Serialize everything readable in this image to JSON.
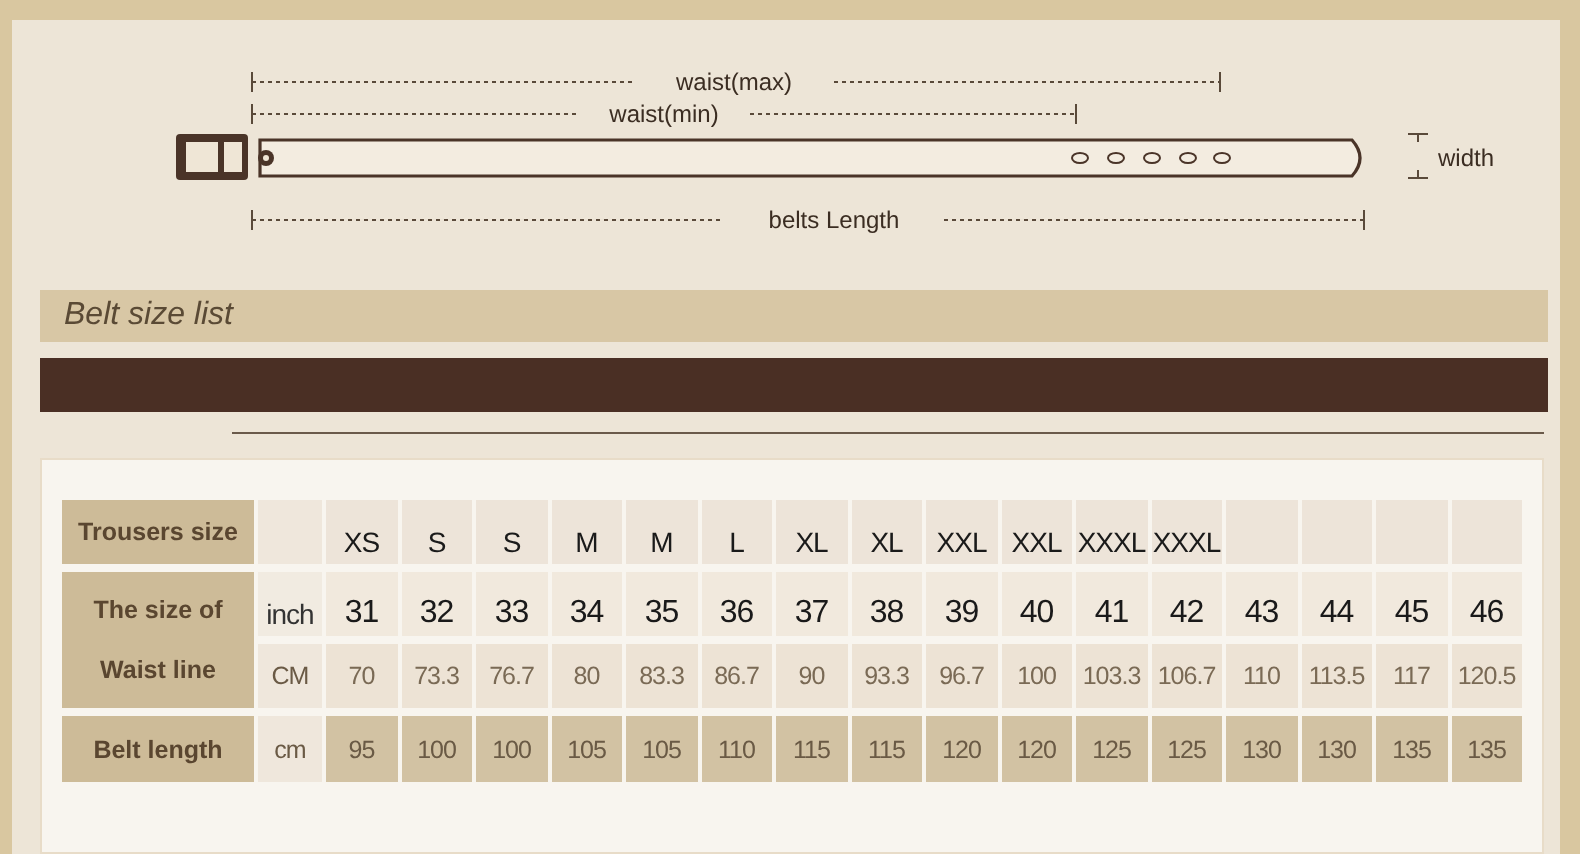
{
  "diagram": {
    "waist_max": "waist(max)",
    "waist_min": "waist(min)",
    "width": "width",
    "belt_length": "belts Length"
  },
  "section_title": "Belt size list",
  "table": {
    "trousers_label": "Trousers size",
    "sizes": [
      "XS",
      "S",
      "S",
      "M",
      "M",
      "L",
      "XL",
      "XL",
      "XXL",
      "XXL",
      "XXXL",
      "XXXL"
    ],
    "waist_label": [
      "The size of",
      "Waist line"
    ],
    "inch_unit": "inch",
    "inches": [
      "31",
      "32",
      "33",
      "34",
      "35",
      "36",
      "37",
      "38",
      "39",
      "40",
      "41",
      "42",
      "43",
      "44",
      "45",
      "46"
    ],
    "cm_unit": "CM",
    "cms": [
      "70",
      "73.3",
      "76.7",
      "80",
      "83.3",
      "86.7",
      "90",
      "93.3",
      "96.7",
      "100",
      "103.3",
      "106.7",
      "110",
      "113.5",
      "117",
      "120.5"
    ],
    "belt_label": "Belt length",
    "belt_unit": "cm",
    "belt_lengths": [
      "95",
      "100",
      "100",
      "105",
      "105",
      "110",
      "115",
      "115",
      "120",
      "120",
      "125",
      "125",
      "130",
      "130",
      "135",
      "135"
    ]
  }
}
